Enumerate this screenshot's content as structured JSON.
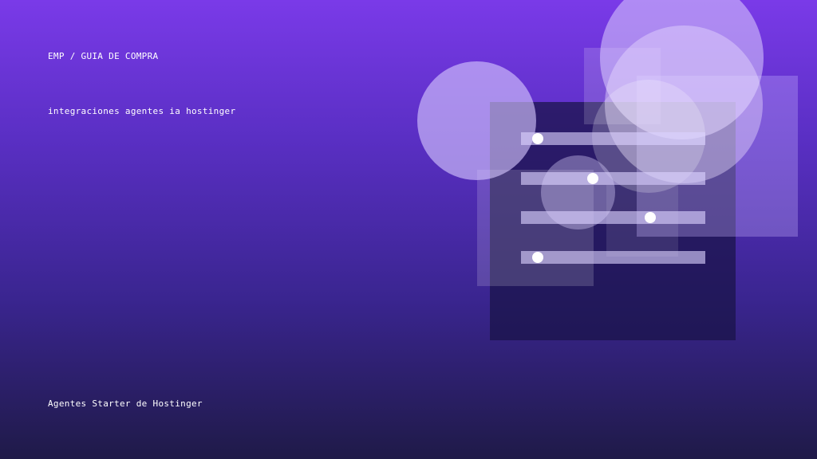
{
  "header": {
    "breadcrumb": "EMP / GUIA DE COMPRA"
  },
  "hero": {
    "subtitle": "integraciones agentes ia hostinger"
  },
  "footer": {
    "label": "Agentes Starter de Hostinger"
  },
  "sliders": [
    {
      "name": "slider-1",
      "value": 0.09
    },
    {
      "name": "slider-2",
      "value": 0.39
    },
    {
      "name": "slider-3",
      "value": 0.7
    },
    {
      "name": "slider-4",
      "value": 0.09
    }
  ],
  "colors": {
    "bg_top": "#7a3ae8",
    "bg_bottom": "#1f1a48",
    "text": "#ffffff"
  }
}
